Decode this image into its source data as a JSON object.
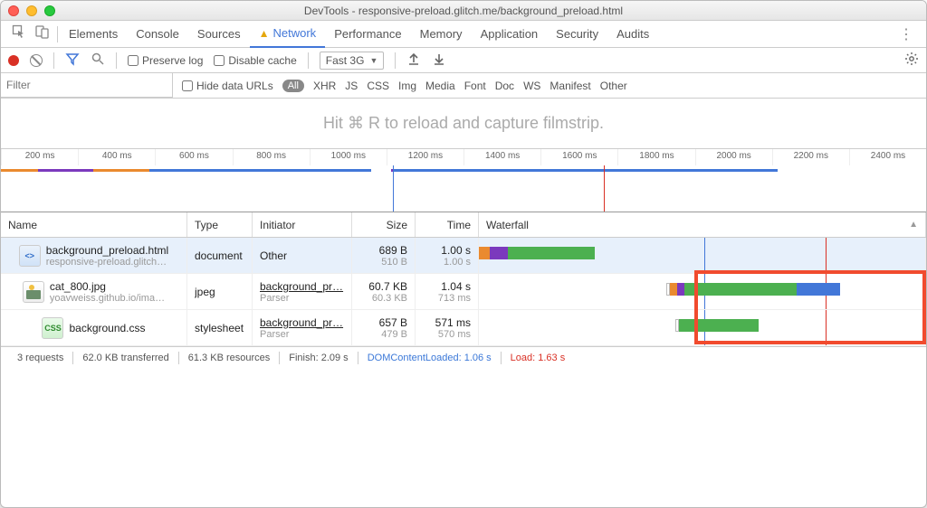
{
  "window": {
    "title": "DevTools - responsive-preload.glitch.me/background_preload.html"
  },
  "tabs": {
    "items": [
      "Elements",
      "Console",
      "Sources",
      "Network",
      "Performance",
      "Memory",
      "Application",
      "Security",
      "Audits"
    ],
    "active_index": 3,
    "warning_on_index": 3
  },
  "toolbar": {
    "preserve_log_label": "Preserve log",
    "disable_cache_label": "Disable cache",
    "throttling_selected": "Fast 3G"
  },
  "filterbar": {
    "placeholder": "Filter",
    "hide_urls_label": "Hide data URLs",
    "types": [
      "All",
      "XHR",
      "JS",
      "CSS",
      "Img",
      "Media",
      "Font",
      "Doc",
      "WS",
      "Manifest",
      "Other"
    ],
    "active_type_index": 0
  },
  "filmstrip": {
    "hint": "Hit ⌘ R to reload and capture filmstrip."
  },
  "timeline": {
    "ticks": [
      "200 ms",
      "400 ms",
      "600 ms",
      "800 ms",
      "1000 ms",
      "1200 ms",
      "1400 ms",
      "1600 ms",
      "1800 ms",
      "2000 ms",
      "2200 ms",
      "2400 ms"
    ],
    "dcl_ms": 1060,
    "load_ms": 1630
  },
  "table": {
    "headers": {
      "name": "Name",
      "type": "Type",
      "initiator": "Initiator",
      "size": "Size",
      "time": "Time",
      "waterfall": "Waterfall"
    },
    "rows": [
      {
        "name": "background_preload.html",
        "name_sub": "responsive-preload.glitch…",
        "icon": "html",
        "type": "document",
        "initiator": "Other",
        "initiator_sub": "",
        "size": "689 B",
        "size_sub": "510 B",
        "time": "1.00 s",
        "time_sub": "1.00 s",
        "selected": true,
        "waterfall": {
          "start_pct": 0,
          "segments": [
            {
              "color": "#ea8a2f",
              "width_pct": 3
            },
            {
              "color": "#7b39bd",
              "width_pct": 5
            },
            {
              "color": "#4cb050",
              "width_pct": 24
            }
          ]
        }
      },
      {
        "name": "cat_800.jpg",
        "name_sub": "yoavweiss.github.io/ima…",
        "icon": "img",
        "type": "jpeg",
        "initiator": "background_pr…",
        "initiator_sub": "Parser",
        "size": "60.7 KB",
        "size_sub": "60.3 KB",
        "time": "1.04 s",
        "time_sub": "713 ms",
        "selected": false,
        "waterfall": {
          "start_pct": 42,
          "segments": [
            {
              "color": "#ea8a2f",
              "width_pct": 2
            },
            {
              "color": "#7b39bd",
              "width_pct": 2
            },
            {
              "color": "#4cb050",
              "width_pct": 31
            },
            {
              "color": "#4277d8",
              "width_pct": 12
            }
          ],
          "shell_pct": 1
        }
      },
      {
        "name": "background.css",
        "name_sub": "",
        "icon": "css",
        "type": "stylesheet",
        "initiator": "background_pr…",
        "initiator_sub": "Parser",
        "size": "657 B",
        "size_sub": "479 B",
        "time": "571 ms",
        "time_sub": "570 ms",
        "selected": false,
        "waterfall": {
          "start_pct": 44,
          "segments": [
            {
              "color": "#4cb050",
              "width_pct": 22
            }
          ],
          "shell_pct": 1
        }
      }
    ],
    "highlight_box": {
      "left_pct": 41,
      "top_row": 1,
      "height_rows": 2
    }
  },
  "statusbar": {
    "requests": "3 requests",
    "transferred": "62.0 KB transferred",
    "resources": "61.3 KB resources",
    "finish": "Finish: 2.09 s",
    "dcl": "DOMContentLoaded: 1.06 s",
    "load": "Load: 1.63 s"
  }
}
